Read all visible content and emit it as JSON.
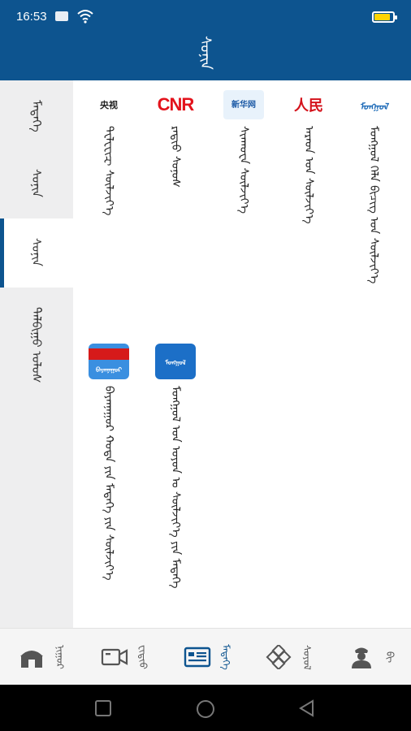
{
  "status_bar": {
    "time": "16:53",
    "battery_level": 0.8,
    "battery_color": "#ffd400"
  },
  "header": {
    "title": "ᠰᠣᠨᠢᠨ",
    "background": "#0d548f"
  },
  "sidebar": {
    "items": [
      {
        "label": "ᠮᠡᠳᠡᠭᠡ"
      },
      {
        "label": "ᠰᠣᠨᠢᠨ"
      },
      {
        "label": "ᠰᠣᠨᠢᠨ"
      },
      {
        "label": "ᠲᠠᠯᠪᠢᠭᠤ ᠤᠯᠤᠰ"
      }
    ],
    "active_index": 2
  },
  "apps": [
    {
      "logo": "ᠮᠣᠩᠭᠣᠯ",
      "name": "ᠮᠣᠩᠭᠤᠯ ᠬᠡᠯᠡ ᠪᠢᠴᠢᠭ ᠤᠨ ᠰᠦᠯᠵᠢᠶ᠎ᠡ"
    },
    {
      "logo": "人民",
      "name": "ᠠᠷᠠᠳ ᠤᠨ ᠰᠦᠯᠵᠢᠶ᠎ᠡ"
    },
    {
      "logo": "新华网",
      "name": "ᠰᠢᠨᠬᠤᠸᠠ ᠰᠦᠯᠵᠢᠶ᠎ᠡ"
    },
    {
      "logo": "CNR",
      "name": "ᠷᠠᠳᠢᠤ ᠰᠤᠨᠤᠰ"
    },
    {
      "logo": "央视",
      "name": "ᠲᠧᠯᠧᠸᠢᠽ ᠰᠦᠯᠵᠢᠶ᠎ᠡ"
    },
    {
      "logo": "ᠪᠠᠶᠠᠨᠨᠠᠭᠤᠷ",
      "name": "ᠪᠠᠶᠠᠨᠨᠠᠭᠤᠷ ᠬᠣᠳᠠ ᠶᠢᠨ ᠮᠡᠳᠡᠭᠡ ᠶᠢᠨ ᠰᠦᠯᠵᠢᠶ᠎ᠡ"
    },
    {
      "logo": "ᠮᠣᠩᠭᠣᠯ",
      "name": "ᠮᠣᠩᠭᠤᠯ ᠤᠨ ᠣᠶᠤᠨ ᠤ ᠰᠦᠯᠵᠢᠶ᠎ᠡ ᠶᠢᠨ ᠮᠡᠳᠡᠭᠡ"
    }
  ],
  "bottom_nav": {
    "items": [
      {
        "label": "ᠨᠢᠭᠤᠷ",
        "icon": "home-ger-icon"
      },
      {
        "label": "ᠸᠢᠳᠢᠣ",
        "icon": "video-camera-icon"
      },
      {
        "label": "ᠮᠡᠳᠡᠭᠡ",
        "icon": "news-card-icon"
      },
      {
        "label": "ᠰᠣᠶᠣᠯ",
        "icon": "knot-pattern-icon"
      },
      {
        "label": "ᠪᠢ",
        "icon": "user-icon"
      }
    ],
    "active_index": 2,
    "active_color": "#0d548f"
  }
}
